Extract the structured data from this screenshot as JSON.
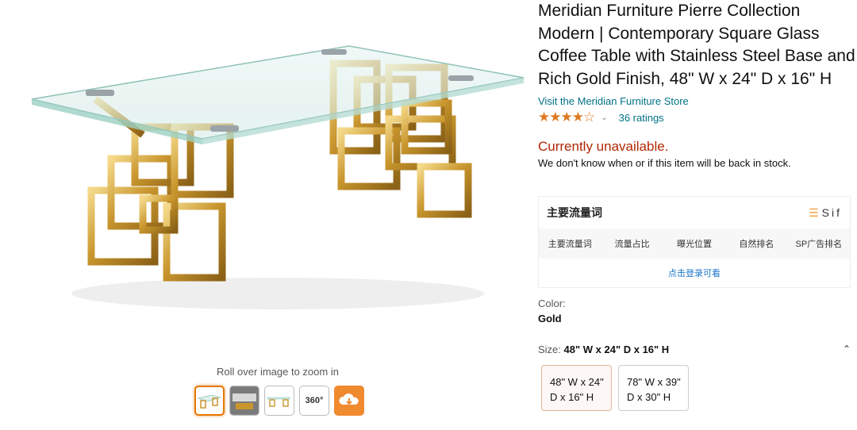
{
  "product": {
    "title": "Meridian Furniture Pierre Collection Modern | Contemporary Square Glass Coffee Table with Stainless Steel Base and Rich Gold Finish, 48\" W x 24\" D x 16\" H",
    "store_link": "Visit the Meridian Furniture Store",
    "rating_stars": "★★★★☆",
    "rating_value": 4.3,
    "ratings_count": "36 ratings",
    "availability": "Currently unavailable.",
    "availability_note": "We don't know when or if this item will be back in stock.",
    "zoom_hint": "Roll over image to zoom in"
  },
  "thumbnails": [
    {
      "icon": "table-photo-icon"
    },
    {
      "icon": "room-photo-icon"
    },
    {
      "icon": "table-angle-icon"
    },
    {
      "icon": "360-view-icon",
      "label": "360°"
    },
    {
      "icon": "cloud-download-icon"
    }
  ],
  "sif": {
    "title": "主要流量词",
    "logo": "Sif",
    "columns": [
      "主要流量词",
      "流量占比",
      "曝光位置",
      "自然排名",
      "SP广告排名"
    ],
    "login_text": "点击登录可看"
  },
  "color": {
    "label": "Color:",
    "value": "Gold"
  },
  "size": {
    "label": "Size:",
    "value": "48\" W x 24\" D x 16\" H",
    "options": [
      {
        "line1": "48\" W x 24\"",
        "line2": "D x 16\" H",
        "selected": true
      },
      {
        "line1": "78\" W x 39\"",
        "line2": "D x 30\" H",
        "selected": false
      }
    ]
  },
  "colors": {
    "link": "#007185",
    "unavailable": "#b12704",
    "star": "#de7921",
    "accent": "#e77600"
  }
}
